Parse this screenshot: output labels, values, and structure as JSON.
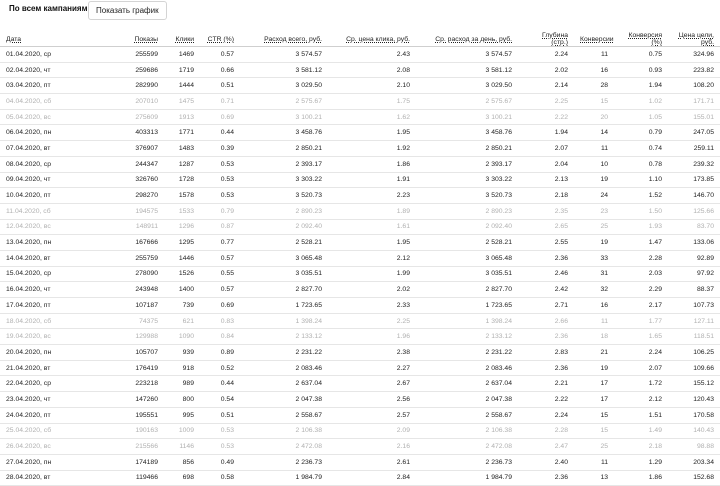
{
  "header": {
    "title": "По всем кампаниям",
    "chart_button": "Показать график"
  },
  "columns": [
    "Дата",
    "Показы",
    "Клики",
    "CTR (%)",
    "Расход всего, руб.",
    "Ср. цена клика, руб.",
    "Ср. расход за день, руб.",
    "Глубина (стр.)",
    "Конверсии",
    "Конверсия (%)",
    "Цена цели, руб."
  ],
  "rows": [
    {
      "date": "01.04.2020, ср",
      "shows": "255599",
      "clicks": "1469",
      "ctr": "0.57",
      "spend": "3 574.57",
      "cpc": "2.43",
      "daily": "3 574.57",
      "depth": "2.24",
      "conv": "11",
      "conv_rate": "0.75",
      "cpa": "324.96",
      "weekend": false
    },
    {
      "date": "02.04.2020, чт",
      "shows": "259686",
      "clicks": "1719",
      "ctr": "0.66",
      "spend": "3 581.12",
      "cpc": "2.08",
      "daily": "3 581.12",
      "depth": "2.02",
      "conv": "16",
      "conv_rate": "0.93",
      "cpa": "223.82",
      "weekend": false
    },
    {
      "date": "03.04.2020, пт",
      "shows": "282990",
      "clicks": "1444",
      "ctr": "0.51",
      "spend": "3 029.50",
      "cpc": "2.10",
      "daily": "3 029.50",
      "depth": "2.14",
      "conv": "28",
      "conv_rate": "1.94",
      "cpa": "108.20",
      "weekend": false
    },
    {
      "date": "04.04.2020, сб",
      "shows": "207010",
      "clicks": "1475",
      "ctr": "0.71",
      "spend": "2 575.67",
      "cpc": "1.75",
      "daily": "2 575.67",
      "depth": "2.25",
      "conv": "15",
      "conv_rate": "1.02",
      "cpa": "171.71",
      "weekend": true
    },
    {
      "date": "05.04.2020, вс",
      "shows": "275609",
      "clicks": "1913",
      "ctr": "0.69",
      "spend": "3 100.21",
      "cpc": "1.62",
      "daily": "3 100.21",
      "depth": "2.22",
      "conv": "20",
      "conv_rate": "1.05",
      "cpa": "155.01",
      "weekend": true
    },
    {
      "date": "06.04.2020, пн",
      "shows": "403313",
      "clicks": "1771",
      "ctr": "0.44",
      "spend": "3 458.76",
      "cpc": "1.95",
      "daily": "3 458.76",
      "depth": "1.94",
      "conv": "14",
      "conv_rate": "0.79",
      "cpa": "247.05",
      "weekend": false
    },
    {
      "date": "07.04.2020, вт",
      "shows": "376907",
      "clicks": "1483",
      "ctr": "0.39",
      "spend": "2 850.21",
      "cpc": "1.92",
      "daily": "2 850.21",
      "depth": "2.07",
      "conv": "11",
      "conv_rate": "0.74",
      "cpa": "259.11",
      "weekend": false
    },
    {
      "date": "08.04.2020, ср",
      "shows": "244347",
      "clicks": "1287",
      "ctr": "0.53",
      "spend": "2 393.17",
      "cpc": "1.86",
      "daily": "2 393.17",
      "depth": "2.04",
      "conv": "10",
      "conv_rate": "0.78",
      "cpa": "239.32",
      "weekend": false
    },
    {
      "date": "09.04.2020, чт",
      "shows": "326760",
      "clicks": "1728",
      "ctr": "0.53",
      "spend": "3 303.22",
      "cpc": "1.91",
      "daily": "3 303.22",
      "depth": "2.13",
      "conv": "19",
      "conv_rate": "1.10",
      "cpa": "173.85",
      "weekend": false
    },
    {
      "date": "10.04.2020, пт",
      "shows": "298270",
      "clicks": "1578",
      "ctr": "0.53",
      "spend": "3 520.73",
      "cpc": "2.23",
      "daily": "3 520.73",
      "depth": "2.18",
      "conv": "24",
      "conv_rate": "1.52",
      "cpa": "146.70",
      "weekend": false
    },
    {
      "date": "11.04.2020, сб",
      "shows": "194575",
      "clicks": "1533",
      "ctr": "0.79",
      "spend": "2 890.23",
      "cpc": "1.89",
      "daily": "2 890.23",
      "depth": "2.35",
      "conv": "23",
      "conv_rate": "1.50",
      "cpa": "125.66",
      "weekend": true
    },
    {
      "date": "12.04.2020, вс",
      "shows": "148911",
      "clicks": "1296",
      "ctr": "0.87",
      "spend": "2 092.40",
      "cpc": "1.61",
      "daily": "2 092.40",
      "depth": "2.65",
      "conv": "25",
      "conv_rate": "1.93",
      "cpa": "83.70",
      "weekend": true
    },
    {
      "date": "13.04.2020, пн",
      "shows": "167666",
      "clicks": "1295",
      "ctr": "0.77",
      "spend": "2 528.21",
      "cpc": "1.95",
      "daily": "2 528.21",
      "depth": "2.55",
      "conv": "19",
      "conv_rate": "1.47",
      "cpa": "133.06",
      "weekend": false
    },
    {
      "date": "14.04.2020, вт",
      "shows": "255759",
      "clicks": "1446",
      "ctr": "0.57",
      "spend": "3 065.48",
      "cpc": "2.12",
      "daily": "3 065.48",
      "depth": "2.36",
      "conv": "33",
      "conv_rate": "2.28",
      "cpa": "92.89",
      "weekend": false
    },
    {
      "date": "15.04.2020, ср",
      "shows": "278090",
      "clicks": "1526",
      "ctr": "0.55",
      "spend": "3 035.51",
      "cpc": "1.99",
      "daily": "3 035.51",
      "depth": "2.46",
      "conv": "31",
      "conv_rate": "2.03",
      "cpa": "97.92",
      "weekend": false
    },
    {
      "date": "16.04.2020, чт",
      "shows": "243948",
      "clicks": "1400",
      "ctr": "0.57",
      "spend": "2 827.70",
      "cpc": "2.02",
      "daily": "2 827.70",
      "depth": "2.42",
      "conv": "32",
      "conv_rate": "2.29",
      "cpa": "88.37",
      "weekend": false
    },
    {
      "date": "17.04.2020, пт",
      "shows": "107187",
      "clicks": "739",
      "ctr": "0.69",
      "spend": "1 723.65",
      "cpc": "2.33",
      "daily": "1 723.65",
      "depth": "2.71",
      "conv": "16",
      "conv_rate": "2.17",
      "cpa": "107.73",
      "weekend": false
    },
    {
      "date": "18.04.2020, сб",
      "shows": "74375",
      "clicks": "621",
      "ctr": "0.83",
      "spend": "1 398.24",
      "cpc": "2.25",
      "daily": "1 398.24",
      "depth": "2.66",
      "conv": "11",
      "conv_rate": "1.77",
      "cpa": "127.11",
      "weekend": true
    },
    {
      "date": "19.04.2020, вс",
      "shows": "129988",
      "clicks": "1090",
      "ctr": "0.84",
      "spend": "2 133.12",
      "cpc": "1.96",
      "daily": "2 133.12",
      "depth": "2.36",
      "conv": "18",
      "conv_rate": "1.65",
      "cpa": "118.51",
      "weekend": true
    },
    {
      "date": "20.04.2020, пн",
      "shows": "105707",
      "clicks": "939",
      "ctr": "0.89",
      "spend": "2 231.22",
      "cpc": "2.38",
      "daily": "2 231.22",
      "depth": "2.83",
      "conv": "21",
      "conv_rate": "2.24",
      "cpa": "106.25",
      "weekend": false
    },
    {
      "date": "21.04.2020, вт",
      "shows": "176419",
      "clicks": "918",
      "ctr": "0.52",
      "spend": "2 083.46",
      "cpc": "2.27",
      "daily": "2 083.46",
      "depth": "2.36",
      "conv": "19",
      "conv_rate": "2.07",
      "cpa": "109.66",
      "weekend": false
    },
    {
      "date": "22.04.2020, ср",
      "shows": "223218",
      "clicks": "989",
      "ctr": "0.44",
      "spend": "2 637.04",
      "cpc": "2.67",
      "daily": "2 637.04",
      "depth": "2.21",
      "conv": "17",
      "conv_rate": "1.72",
      "cpa": "155.12",
      "weekend": false
    },
    {
      "date": "23.04.2020, чт",
      "shows": "147260",
      "clicks": "800",
      "ctr": "0.54",
      "spend": "2 047.38",
      "cpc": "2.56",
      "daily": "2 047.38",
      "depth": "2.22",
      "conv": "17",
      "conv_rate": "2.12",
      "cpa": "120.43",
      "weekend": false
    },
    {
      "date": "24.04.2020, пт",
      "shows": "195551",
      "clicks": "995",
      "ctr": "0.51",
      "spend": "2 558.67",
      "cpc": "2.57",
      "daily": "2 558.67",
      "depth": "2.24",
      "conv": "15",
      "conv_rate": "1.51",
      "cpa": "170.58",
      "weekend": false
    },
    {
      "date": "25.04.2020, сб",
      "shows": "190163",
      "clicks": "1009",
      "ctr": "0.53",
      "spend": "2 106.38",
      "cpc": "2.09",
      "daily": "2 106.38",
      "depth": "2.28",
      "conv": "15",
      "conv_rate": "1.49",
      "cpa": "140.43",
      "weekend": true
    },
    {
      "date": "26.04.2020, вс",
      "shows": "215566",
      "clicks": "1146",
      "ctr": "0.53",
      "spend": "2 472.08",
      "cpc": "2.16",
      "daily": "2 472.08",
      "depth": "2.47",
      "conv": "25",
      "conv_rate": "2.18",
      "cpa": "98.88",
      "weekend": true
    },
    {
      "date": "27.04.2020, пн",
      "shows": "174189",
      "clicks": "856",
      "ctr": "0.49",
      "spend": "2 236.73",
      "cpc": "2.61",
      "daily": "2 236.73",
      "depth": "2.40",
      "conv": "11",
      "conv_rate": "1.29",
      "cpa": "203.34",
      "weekend": false
    },
    {
      "date": "28.04.2020, вт",
      "shows": "119466",
      "clicks": "698",
      "ctr": "0.58",
      "spend": "1 984.79",
      "cpc": "2.84",
      "daily": "1 984.79",
      "depth": "2.36",
      "conv": "13",
      "conv_rate": "1.86",
      "cpa": "152.68",
      "weekend": false
    }
  ]
}
